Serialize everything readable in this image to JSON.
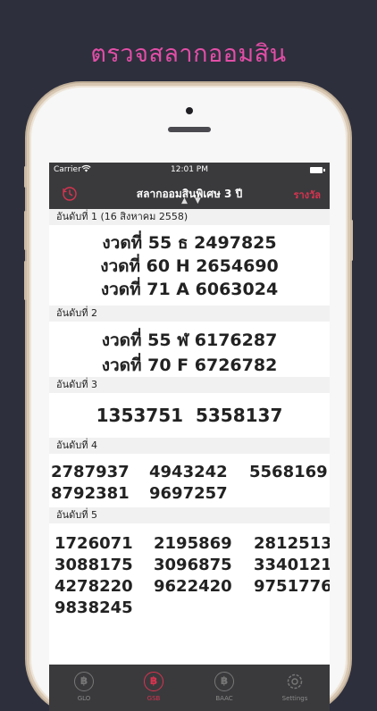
{
  "promo": {
    "title": "ตรวจสลากออมสิน"
  },
  "status": {
    "carrier": "Carrier",
    "time": "12:01 PM"
  },
  "nav": {
    "title": "สลากออมสินพิเศษ 3 ปี",
    "rewards_label": "รางวัล",
    "arrows": "▲▼"
  },
  "prizes": [
    {
      "heading": "อันดับที่ 1 (16 สิงหาคม 2558)",
      "lines": [
        "งวดที่ 55 ธ 2497825",
        "งวดที่ 60 H 2654690",
        "งวดที่ 71 A 6063024"
      ]
    },
    {
      "heading": "อันดับที่ 2",
      "lines": [
        "งวดที่ 55 ฬ 6176287",
        "งวดที่ 70 F 6726782"
      ]
    },
    {
      "heading": "อันดับที่ 3",
      "lines": [
        "1353751  5358137"
      ]
    },
    {
      "heading": "อันดับที่ 4",
      "numbers": [
        "2787937",
        "4943242",
        "5568169",
        "8792381",
        "9697257"
      ]
    },
    {
      "heading": "อันดับที่ 5",
      "numbers": [
        "1726071",
        "2195869",
        "2812513",
        "3088175",
        "3096875",
        "3340121",
        "4278220",
        "9622420",
        "9751776",
        "9838245"
      ]
    }
  ],
  "tabs": [
    {
      "label": "GLO",
      "icon": "baht-coin-icon",
      "active": false
    },
    {
      "label": "GSB",
      "icon": "baht-coin-icon",
      "active": true
    },
    {
      "label": "BAAC",
      "icon": "baht-coin-icon",
      "active": false
    },
    {
      "label": "Settings",
      "icon": "gear-icon",
      "active": false
    }
  ],
  "colors": {
    "accent": "#d9334f",
    "promo": "#e24ea6",
    "bar": "#3a3a3d",
    "background": "#2d2f3d"
  }
}
